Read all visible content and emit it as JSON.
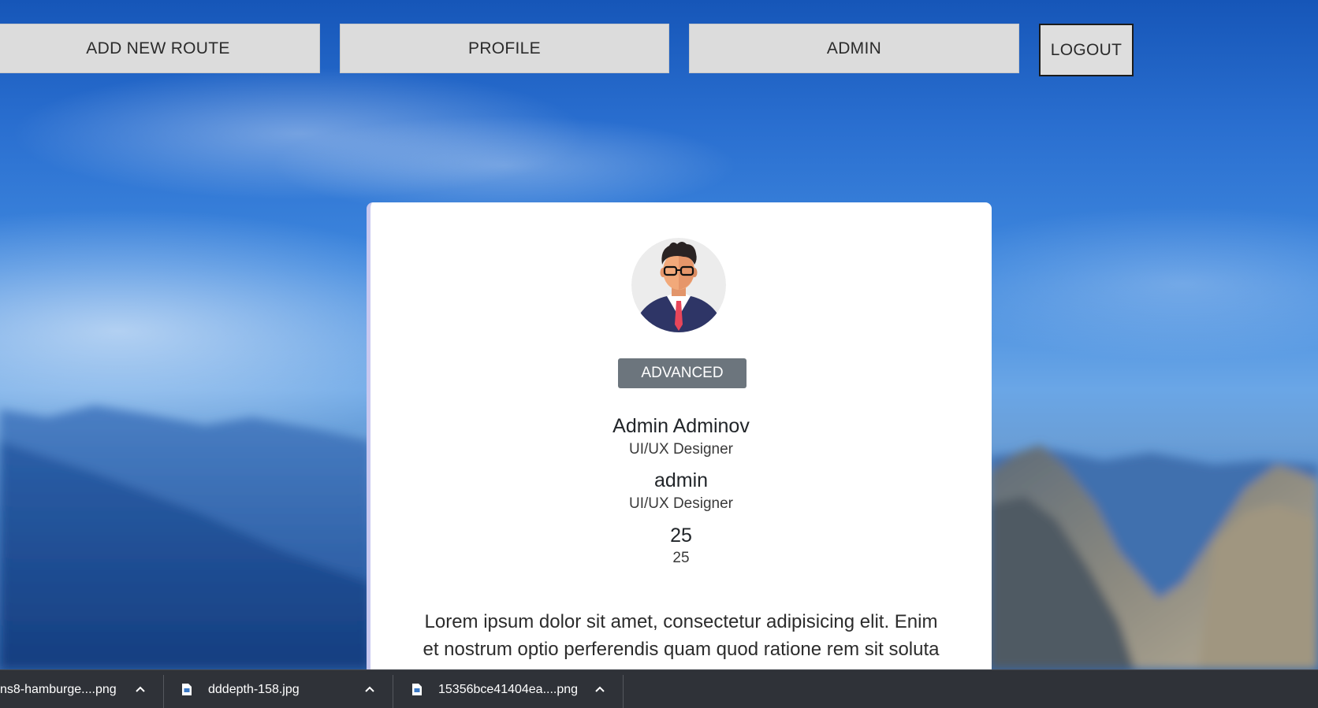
{
  "nav": {
    "add_route": "ADD NEW ROUTE",
    "profile": "PROFILE",
    "admin": "ADMIN",
    "logout": "LOGOUT"
  },
  "profile": {
    "badge": "ADVANCED",
    "full_name": "Admin Adminov",
    "full_name_role": "UI/UX Designer",
    "username": "admin",
    "username_role": "UI/UX Designer",
    "age": "25",
    "age_sub": "25",
    "bio_line1": "Lorem ipsum dolor sit amet, consectetur adipisicing elit. Enim",
    "bio_line2": "et nostrum optio perferendis quam quod ratione rem sit soluta"
  },
  "downloads": [
    {
      "name": "ns8-hamburge....png",
      "icon": "file-icon"
    },
    {
      "name": "dddepth-158.jpg",
      "icon": "file-icon"
    },
    {
      "name": "15356bce41404ea....png",
      "icon": "file-icon"
    }
  ],
  "colors": {
    "badge_bg": "#6c757d",
    "nav_bg": "#dcdcdc",
    "download_bar_bg": "#2f3238",
    "card_accent": "#c8c8f0"
  }
}
